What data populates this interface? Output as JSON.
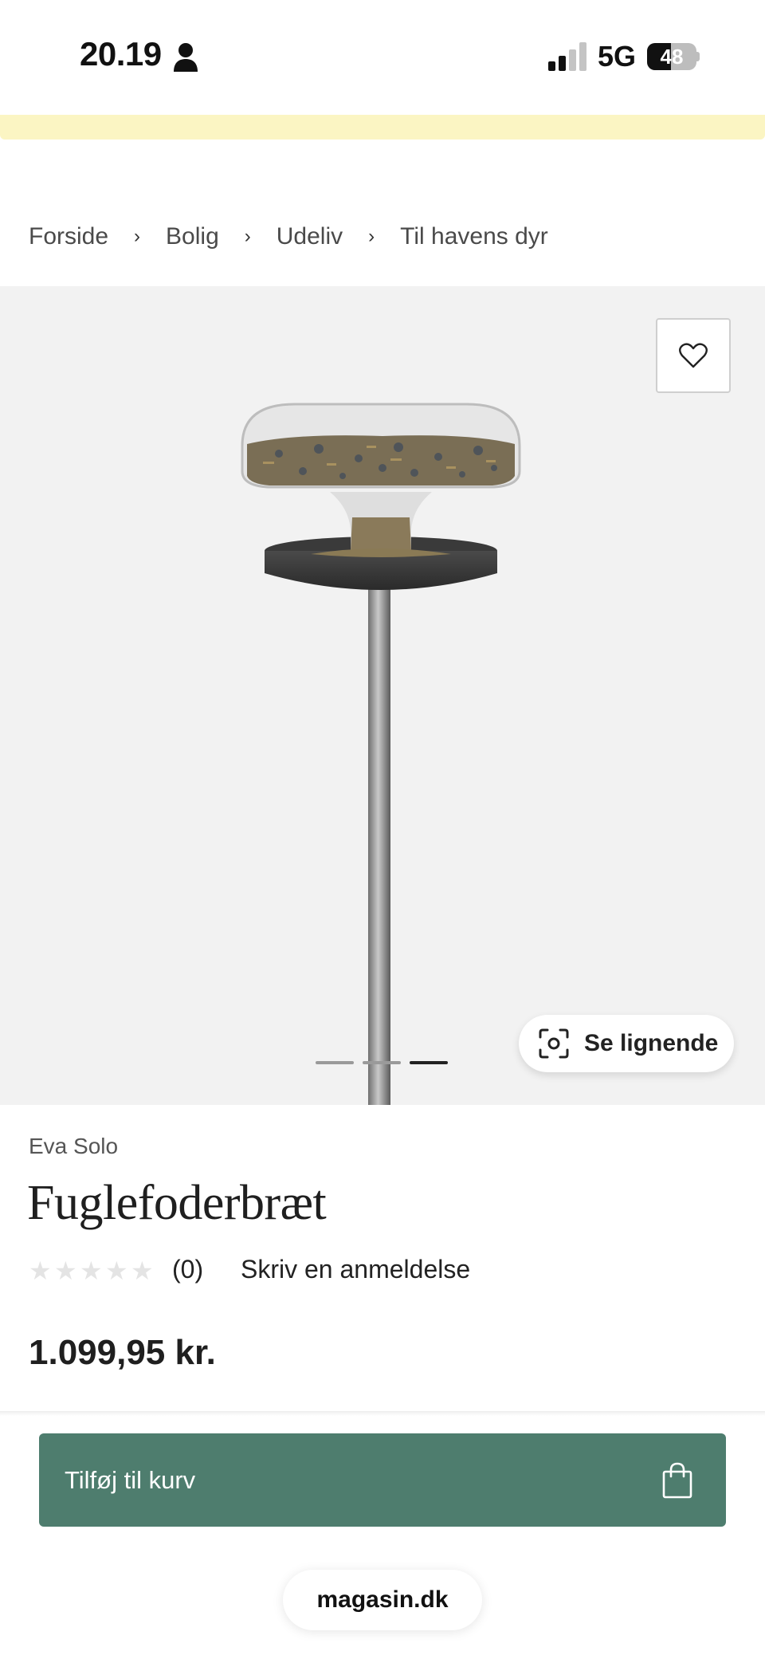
{
  "status_bar": {
    "time": "20.19",
    "network": "5G",
    "battery_level": "48",
    "battery_fraction": 0.48,
    "signal_bars_active": 2,
    "signal_bars_total": 4
  },
  "breadcrumb": {
    "items": [
      "Forside",
      "Bolig",
      "Udeliv",
      "Til havens dyr"
    ],
    "separator": "›"
  },
  "gallery": {
    "image_alt": "bird-feeder-product-image",
    "slide_count": 3,
    "active_slide": 3,
    "similar_label": "Se lignende",
    "wishlist_icon": "heart-icon"
  },
  "product": {
    "brand": "Eva Solo",
    "title": "Fuglefoderbræt",
    "rating_stars": 0,
    "rating_max": 5,
    "review_count": "(0)",
    "write_review": "Skriv en anmeldelse",
    "price": "1.099,95 kr."
  },
  "cta": {
    "add_to_cart": "Tilføj til kurv",
    "icon": "shopping-bag-icon",
    "color": "#4e7d6e"
  },
  "browser": {
    "url": "magasin.dk"
  },
  "colors": {
    "promo_banner": "#fbf5c3",
    "gallery_bg": "#f2f2f2"
  }
}
